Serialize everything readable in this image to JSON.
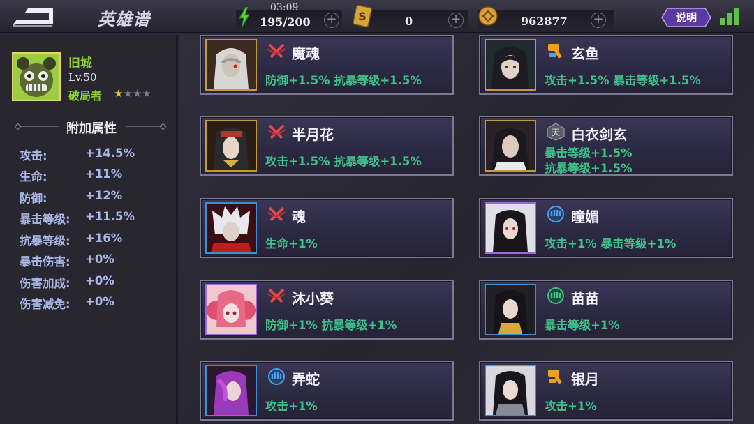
{
  "header": {
    "title": "英雄谱",
    "timer": "03:09",
    "stamina": "195/200",
    "tickets": "0",
    "coins": "962877",
    "help_label": "说明"
  },
  "profile": {
    "name": "旧城",
    "level": "Lv.50",
    "rank": "破局者",
    "stars_filled": 1,
    "stars_total": 4
  },
  "attributes": {
    "title": "附加属性",
    "rows": [
      {
        "label": "攻击:",
        "value": "+14.5%"
      },
      {
        "label": "生命:",
        "value": "+11%"
      },
      {
        "label": "防御:",
        "value": "+12%"
      },
      {
        "label": "暴击等级:",
        "value": "+11.5%"
      },
      {
        "label": "抗暴等级:",
        "value": "+16%"
      },
      {
        "label": "暴击伤害:",
        "value": "+0%"
      },
      {
        "label": "伤害加成:",
        "value": "+0%"
      },
      {
        "label": "伤害减免:",
        "value": "+0%"
      }
    ]
  },
  "heroes": [
    {
      "name": "魔魂",
      "bonus1": "防御+1.5% 抗暴等级+1.5%",
      "bonus2": "",
      "frame": "gold",
      "icon": "crossed-swords-icon",
      "icon_color": "#e04848"
    },
    {
      "name": "玄鱼",
      "bonus1": "攻击+1.5% 暴击等级+1.5%",
      "bonus2": "",
      "frame": "gold",
      "icon": "hammer-icon",
      "icon_color": "#f0a020"
    },
    {
      "name": "半月花",
      "bonus1": "攻击+1.5% 抗暴等级+1.5%",
      "bonus2": "",
      "frame": "gold",
      "icon": "crossed-swords-icon",
      "icon_color": "#e04848"
    },
    {
      "name": "白衣剑玄",
      "bonus1": "暴击等级+1.5%",
      "bonus2": "抗暴等级+1.5%",
      "frame": "gold",
      "icon": "tian-badge-icon",
      "icon_color": "#aaaaaa"
    },
    {
      "name": "魂",
      "bonus1": "生命+1%",
      "bonus2": "",
      "frame": "blue",
      "icon": "crossed-swords-icon",
      "icon_color": "#e04848"
    },
    {
      "name": "瞳媚",
      "bonus1": "攻击+1% 暴击等级+1%",
      "bonus2": "",
      "frame": "purple",
      "icon": "fist-icon",
      "icon_color": "#4aa0f0"
    },
    {
      "name": "沐小葵",
      "bonus1": "防御+1% 抗暴等级+1%",
      "bonus2": "",
      "frame": "purple",
      "icon": "crossed-swords-icon",
      "icon_color": "#e04848"
    },
    {
      "name": "苗苗",
      "bonus1": "暴击等级+1%",
      "bonus2": "",
      "frame": "blue",
      "icon": "fist-icon",
      "icon_color": "#3fc18a"
    },
    {
      "name": "弄蛇",
      "bonus1": "攻击+1%",
      "bonus2": "",
      "frame": "blue",
      "icon": "fist-icon",
      "icon_color": "#4aa0f0"
    },
    {
      "name": "银月",
      "bonus1": "攻击+1%",
      "bonus2": "",
      "frame": "blue",
      "icon": "hammer-icon",
      "icon_color": "#f0a020"
    }
  ]
}
